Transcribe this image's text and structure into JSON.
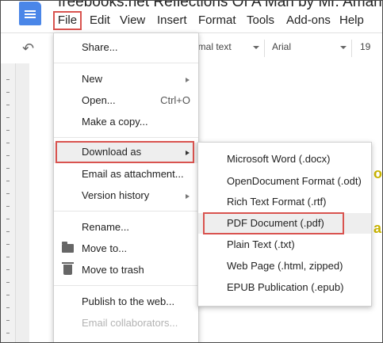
{
  "document": {
    "title": "freebooks.net Reflections Of A Man by Mr. Amari"
  },
  "menubar": {
    "items": [
      "File",
      "Edit",
      "View",
      "Insert",
      "Format",
      "Tools",
      "Add-ons",
      "Help"
    ]
  },
  "toolbar": {
    "style_value": "ormal text",
    "font_value": "Arial",
    "size_value": "19"
  },
  "page": {
    "text_fragment_1": "o",
    "text_fragment_2": "ar"
  },
  "file_menu": {
    "share": "Share...",
    "new": "New",
    "open": "Open...",
    "open_shortcut": "Ctrl+O",
    "make_copy": "Make a copy...",
    "download_as": "Download as",
    "email_attachment": "Email as attachment...",
    "version_history": "Version history",
    "rename": "Rename...",
    "move_to": "Move to...",
    "move_to_trash": "Move to trash",
    "publish": "Publish to the web...",
    "email_collaborators": "Email collaborators..."
  },
  "download_submenu": {
    "items": [
      "Microsoft Word (.docx)",
      "OpenDocument Format (.odt)",
      "Rich Text Format (.rtf)",
      "PDF Document (.pdf)",
      "Plain Text (.txt)",
      "Web Page (.html, zipped)",
      "EPUB Publication (.epub)"
    ]
  },
  "colors": {
    "highlight_border": "#d9534f",
    "docs_blue": "#4a86e8",
    "page_text": "#c9b400"
  },
  "icons": [
    "docs-icon",
    "undo-icon",
    "folder-icon",
    "trash-icon",
    "chevron-right-icon"
  ]
}
